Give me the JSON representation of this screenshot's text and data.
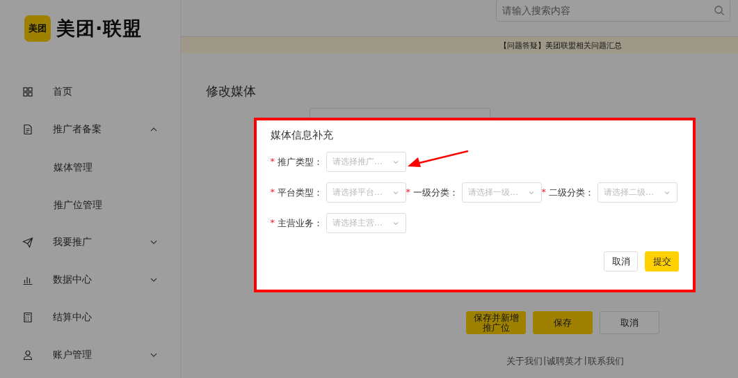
{
  "sidebar": {
    "logo": {
      "badge": "美团",
      "name": "美团·联盟"
    },
    "items": [
      {
        "label": "首页"
      },
      {
        "label": "推广者备案",
        "expanded": true,
        "children": [
          {
            "label": "媒体管理"
          },
          {
            "label": "推广位管理"
          }
        ]
      },
      {
        "label": "我要推广",
        "expanded": false
      },
      {
        "label": "数据中心",
        "expanded": false
      },
      {
        "label": "结算中心"
      },
      {
        "label": "账户管理",
        "expanded": false
      }
    ]
  },
  "search": {
    "placeholder": "请输入搜索内容"
  },
  "notice": "【问题答疑】美团联盟相关问题汇总",
  "page": {
    "title": "修改媒体",
    "buttons": [
      {
        "label": "保存并新增推广位",
        "kind": "primary"
      },
      {
        "label": "保存",
        "kind": "primary"
      },
      {
        "label": "取消",
        "kind": "default"
      }
    ]
  },
  "footer": {
    "links": [
      "关于我们",
      "诚聘英才",
      "联系我们"
    ],
    "separator": "|"
  },
  "dialog": {
    "title": "媒体信息补充",
    "required_mark": "*",
    "rows": [
      [
        {
          "label": "推广类型：",
          "placeholder": "请选择推广…",
          "required": true
        }
      ],
      [
        {
          "label": "平台类型：",
          "placeholder": "请选择平台…",
          "required": true
        },
        {
          "label": "一级分类：",
          "placeholder": "请选择一级…",
          "required": true
        },
        {
          "label": "二级分类：",
          "placeholder": "请选择二级…",
          "required": true
        }
      ],
      [
        {
          "label": "主营业务：",
          "placeholder": "请选择主营…",
          "required": true
        }
      ]
    ],
    "buttons": [
      {
        "label": "取消",
        "kind": "default"
      },
      {
        "label": "提交",
        "kind": "primary"
      }
    ]
  }
}
